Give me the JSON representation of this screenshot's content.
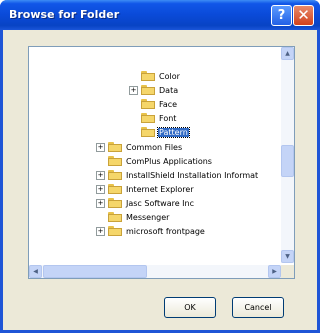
{
  "window": {
    "title": "Browse for Folder",
    "help_glyph": "?",
    "close_glyph": "✕"
  },
  "tree": {
    "items": [
      {
        "label": "Color",
        "level": 2,
        "expander": ""
      },
      {
        "label": "Data",
        "level": 2,
        "expander": "+"
      },
      {
        "label": "Face",
        "level": 2,
        "expander": ""
      },
      {
        "label": "Font",
        "level": 2,
        "expander": ""
      },
      {
        "label": "Pattern",
        "level": 2,
        "expander": "",
        "selected": true
      },
      {
        "label": "Common Files",
        "level": 1,
        "expander": "+"
      },
      {
        "label": "ComPlus Applications",
        "level": 1,
        "expander": ""
      },
      {
        "label": "InstallShield Installation Informat",
        "level": 1,
        "expander": "+"
      },
      {
        "label": "Internet Explorer",
        "level": 1,
        "expander": "+"
      },
      {
        "label": "Jasc Software Inc",
        "level": 1,
        "expander": "+"
      },
      {
        "label": "Messenger",
        "level": 1,
        "expander": ""
      },
      {
        "label": "microsoft frontpage",
        "level": 1,
        "expander": "+"
      }
    ]
  },
  "scroll": {
    "up": "▲",
    "down": "▼",
    "left": "◀",
    "right": "▶"
  },
  "buttons": {
    "ok": "OK",
    "cancel": "Cancel"
  },
  "colors": {
    "titlebar": "#0a4ad8",
    "selection": "#316ac5",
    "dialog_face": "#ece9d8"
  }
}
